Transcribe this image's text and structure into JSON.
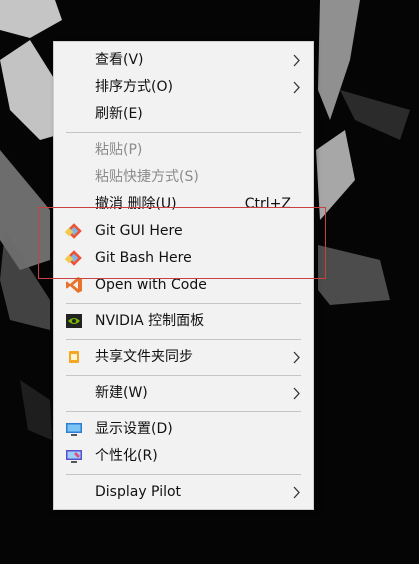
{
  "menu": {
    "sections": [
      {
        "items": [
          {
            "label": "查看(V)",
            "submenu": true,
            "icon": null
          },
          {
            "label": "排序方式(O)",
            "submenu": true,
            "icon": null
          },
          {
            "label": "刷新(E)",
            "submenu": false,
            "icon": null
          }
        ]
      },
      {
        "items": [
          {
            "label": "粘贴(P)",
            "disabled": true
          },
          {
            "label": "粘贴快捷方式(S)",
            "disabled": true
          },
          {
            "label": "撤消 删除(U)",
            "shortcut": "Ctrl+Z"
          },
          {
            "label": "Git GUI Here",
            "icon": "git-gui-icon"
          },
          {
            "label": "Git Bash Here",
            "icon": "git-bash-icon"
          },
          {
            "label": "Open with Code",
            "icon": "vscode-icon"
          }
        ]
      },
      {
        "items": [
          {
            "label": "NVIDIA 控制面板",
            "icon": "nvidia-icon"
          }
        ]
      },
      {
        "items": [
          {
            "label": "共享文件夹同步",
            "icon": "share-sync-icon",
            "submenu": true
          }
        ]
      },
      {
        "items": [
          {
            "label": "新建(W)",
            "submenu": true
          }
        ]
      },
      {
        "items": [
          {
            "label": "显示设置(D)",
            "icon": "display-settings-icon"
          },
          {
            "label": "个性化(R)",
            "icon": "personalize-icon"
          }
        ]
      },
      {
        "items": [
          {
            "label": "Display Pilot",
            "submenu": true
          }
        ]
      }
    ]
  },
  "colors": {
    "menu_bg": "#f2f2f2",
    "text": "#111111",
    "disabled_text": "#8b8b8b",
    "highlight_border": "#c94040"
  }
}
